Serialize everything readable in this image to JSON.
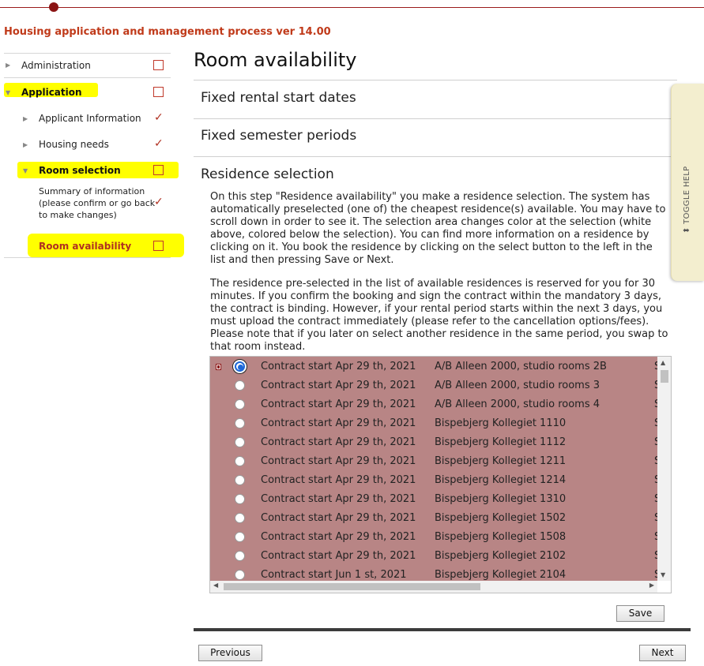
{
  "app": {
    "title": "Housing application and management process ver 14.00"
  },
  "colors": {
    "accent": "#c03a1a",
    "highlight": "#ffff00",
    "list_bg": "#b88585"
  },
  "sidebar": {
    "items": [
      {
        "label": "Administration",
        "status": "box"
      },
      {
        "label": "Application",
        "status": "box"
      },
      {
        "label": "Applicant Information",
        "status": "check"
      },
      {
        "label": "Housing needs",
        "status": "check"
      },
      {
        "label": "Room selection",
        "status": "box"
      },
      {
        "label": "Summary of information (please confirm or go back to make changes)",
        "status": "check"
      },
      {
        "label": "Room availability",
        "status": "box"
      }
    ]
  },
  "main": {
    "title": "Room availability",
    "sections": [
      {
        "label": "Fixed rental start dates"
      },
      {
        "label": "Fixed semester periods"
      },
      {
        "label": "Residence selection"
      }
    ],
    "paragraph1": "On this step \"Residence availability\" you make a residence selection. The system has automatically preselected (one of) the cheapest residence(s) available. You may have to scroll down in order to see it. The selection area changes color at the selection (white above, colored below the selection). You can find more information on a residence by clicking on it. You book the residence by clicking on the select button to the left in the list and then pressing Save or Next.",
    "paragraph2": "The residence pre-selected in the list of available residences is reserved for you for 30 minutes. If you confirm the booking and sign the contract within the mandatory 3 days, the contract is binding. However, if your rental period starts within the next 3 days, you must upload the contract immediately (please refer to the cancellation options/fees). Please note that if you later on select another residence in the same period, you swap to that room instead."
  },
  "residences": [
    {
      "contract": "Contract start Apr 29 th, 2021",
      "name": "A/B Alleen 2000, studio rooms 2B",
      "extra": "S",
      "selected": true
    },
    {
      "contract": "Contract start Apr 29 th, 2021",
      "name": "A/B Alleen 2000, studio rooms 3",
      "extra": "S",
      "selected": false
    },
    {
      "contract": "Contract start Apr 29 th, 2021",
      "name": "A/B Alleen 2000, studio rooms 4",
      "extra": "S",
      "selected": false
    },
    {
      "contract": "Contract start Apr 29 th, 2021",
      "name": "Bispebjerg Kollegiet 1110",
      "extra": "S",
      "selected": false
    },
    {
      "contract": "Contract start Apr 29 th, 2021",
      "name": "Bispebjerg Kollegiet 1112",
      "extra": "S",
      "selected": false
    },
    {
      "contract": "Contract start Apr 29 th, 2021",
      "name": "Bispebjerg Kollegiet 1211",
      "extra": "S",
      "selected": false
    },
    {
      "contract": "Contract start Apr 29 th, 2021",
      "name": "Bispebjerg Kollegiet 1214",
      "extra": "S",
      "selected": false
    },
    {
      "contract": "Contract start Apr 29 th, 2021",
      "name": "Bispebjerg Kollegiet 1310",
      "extra": "S",
      "selected": false
    },
    {
      "contract": "Contract start Apr 29 th, 2021",
      "name": "Bispebjerg Kollegiet 1502",
      "extra": "S",
      "selected": false
    },
    {
      "contract": "Contract start Apr 29 th, 2021",
      "name": "Bispebjerg Kollegiet 1508",
      "extra": "S",
      "selected": false
    },
    {
      "contract": "Contract start Apr 29 th, 2021",
      "name": "Bispebjerg Kollegiet 2102",
      "extra": "S",
      "selected": false
    },
    {
      "contract": "Contract start Jun 1 st, 2021",
      "name": "Bispebjerg Kollegiet 2104",
      "extra": "S",
      "selected": false
    }
  ],
  "buttons": {
    "save": "Save",
    "previous": "Previous",
    "next": "Next"
  },
  "help": {
    "toggle_label": "TOGGLE HELP"
  }
}
